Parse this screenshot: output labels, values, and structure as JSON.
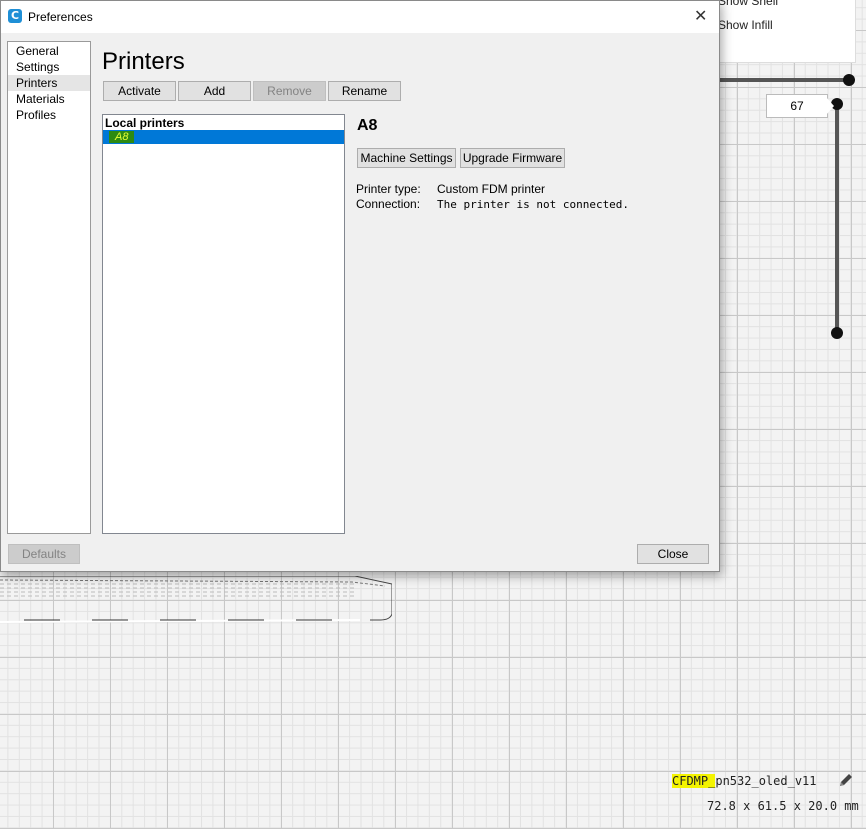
{
  "view_panel": {
    "option1": "Show Shell",
    "option2": "Show Infill"
  },
  "layer_slider": {
    "value": "67"
  },
  "model": {
    "name_highlight": "CFDMP_",
    "name_rest": "pn532_oled_v11",
    "dimensions": "72.8 x 61.5 x 20.0 mm",
    "edit_icon": "pencil-icon"
  },
  "dialog": {
    "title": "Preferences",
    "app_icon": "C",
    "close_glyph": "✕",
    "sidebar": [
      {
        "label": "General"
      },
      {
        "label": "Settings"
      },
      {
        "label": "Printers"
      },
      {
        "label": "Materials"
      },
      {
        "label": "Profiles"
      }
    ],
    "page_title": "Printers",
    "toolbar": {
      "activate": "Activate",
      "add": "Add",
      "remove": "Remove",
      "rename": "Rename"
    },
    "list": {
      "header": "Local printers",
      "selected": "A8"
    },
    "printer": {
      "name": "A8",
      "machine_settings": "Machine Settings",
      "upgrade_firmware": "Upgrade Firmware",
      "type_label": "Printer type:",
      "type_value": "Custom FDM printer",
      "connection_label": "Connection:",
      "connection_value": "The printer is not connected."
    },
    "footer": {
      "defaults": "Defaults",
      "close": "Close"
    }
  }
}
